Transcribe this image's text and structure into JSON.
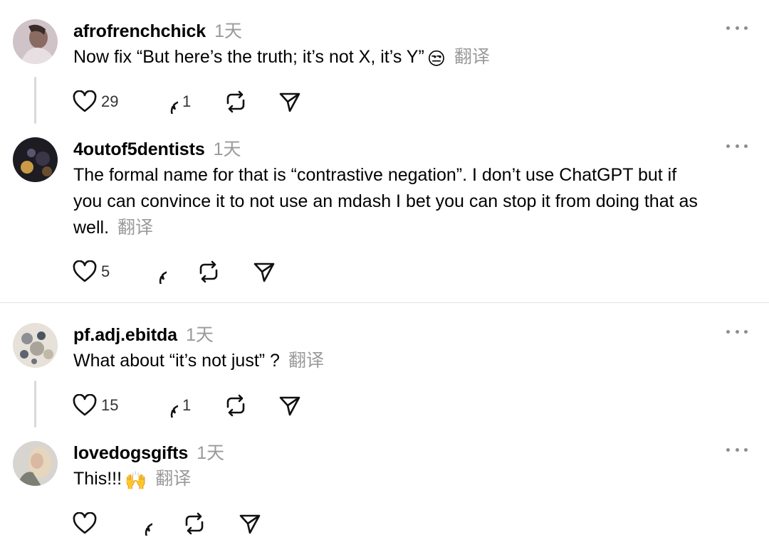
{
  "posts": [
    {
      "username": "afrofrenchchick",
      "time": "1天",
      "text": "Now fix “But here’s the truth; it’s not X, it’s Y”",
      "emoji": "😒",
      "translate": "翻译",
      "likes": "29",
      "replies": "1"
    },
    {
      "username": "4outof5dentists",
      "time": "1天",
      "text_lines": [
        "The formal name for that is “contrastive negation”. I don’t use ChatGPT but if",
        "you can convince it to not use an mdash I bet you can stop it from doing that as",
        "well."
      ],
      "translate": "翻译",
      "likes": "5"
    },
    {
      "username": "pf.adj.ebitda",
      "time": "1天",
      "text": "What about “it’s not just” ?",
      "translate": "翻译",
      "likes": "15",
      "replies": "1"
    },
    {
      "username": "lovedogsgifts",
      "time": "1天",
      "text": "This!!!",
      "emoji": "🙌",
      "translate": "翻译"
    }
  ],
  "icons": {
    "like": "heart-icon",
    "reply": "comment-icon",
    "repost": "repost-icon",
    "share": "send-icon",
    "more": "more-icon"
  },
  "colors": {
    "muted_text": "#9a9a9a",
    "thread_line": "#d9d9d9",
    "separator": "#e2e2e2"
  }
}
